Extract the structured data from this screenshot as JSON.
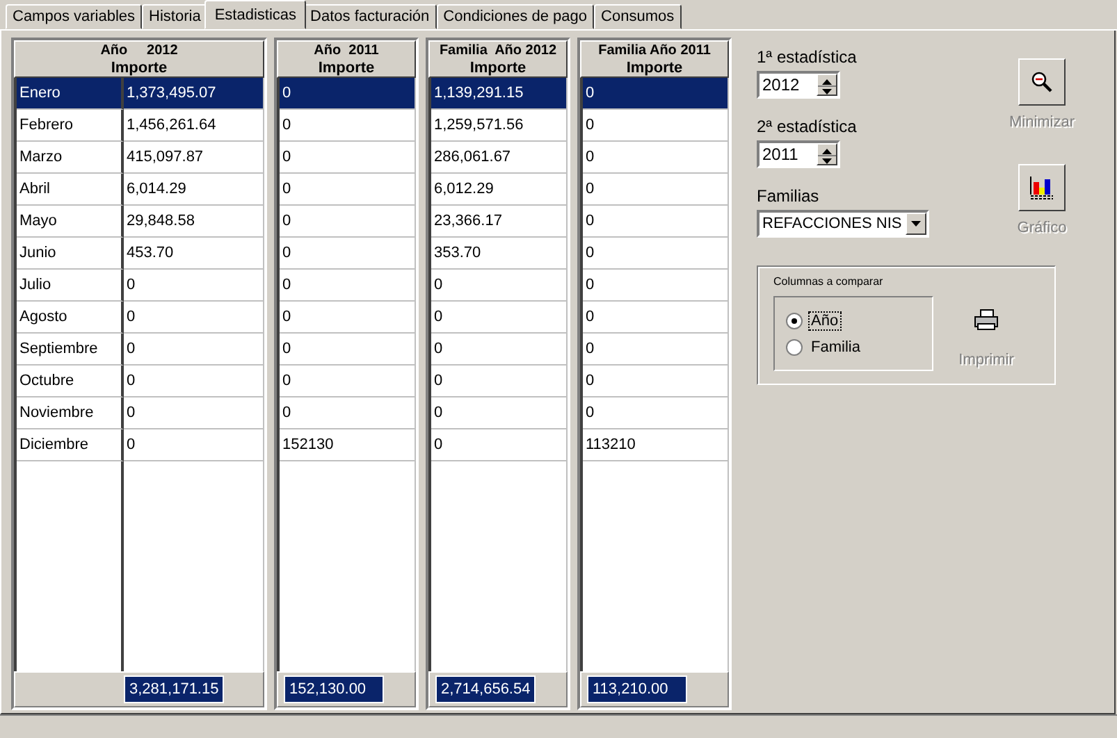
{
  "tabs": [
    {
      "label": "Campos variables",
      "selected": false
    },
    {
      "label": "Historia",
      "selected": false
    },
    {
      "label": "Estadisticas",
      "selected": true
    },
    {
      "label": "Datos facturación",
      "selected": false
    },
    {
      "label": "Condiciones de pago",
      "selected": false
    },
    {
      "label": "Consumos",
      "selected": false
    }
  ],
  "grid": {
    "columns": [
      {
        "title": "Año     2012",
        "subtitle": "Importe",
        "total": "3,281,171.15"
      },
      {
        "title": "Año  2011",
        "subtitle": "Importe",
        "total": "152,130.00"
      },
      {
        "title": "Familia  Año 2012",
        "subtitle": "Importe",
        "total": "2,714,656.54"
      },
      {
        "title": "Familia Año 2011",
        "subtitle": "Importe",
        "total": "113,210.00"
      }
    ],
    "rows": [
      {
        "month": "Enero",
        "values": [
          "1,373,495.07",
          "0",
          "1,139,291.15",
          "0"
        ],
        "selected": true
      },
      {
        "month": "Febrero",
        "values": [
          "1,456,261.64",
          "0",
          "1,259,571.56",
          "0"
        ],
        "selected": false
      },
      {
        "month": "Marzo",
        "values": [
          "415,097.87",
          "0",
          "286,061.67",
          "0"
        ],
        "selected": false
      },
      {
        "month": "Abril",
        "values": [
          "6,014.29",
          "0",
          "6,012.29",
          "0"
        ],
        "selected": false
      },
      {
        "month": "Mayo",
        "values": [
          "29,848.58",
          "0",
          "23,366.17",
          "0"
        ],
        "selected": false
      },
      {
        "month": "Junio",
        "values": [
          "453.70",
          "0",
          "353.70",
          "0"
        ],
        "selected": false
      },
      {
        "month": "Julio",
        "values": [
          "0",
          "0",
          "0",
          "0"
        ],
        "selected": false
      },
      {
        "month": "Agosto",
        "values": [
          "0",
          "0",
          "0",
          "0"
        ],
        "selected": false
      },
      {
        "month": "Septiembre",
        "values": [
          "0",
          "0",
          "0",
          "0"
        ],
        "selected": false
      },
      {
        "month": "Octubre",
        "values": [
          "0",
          "0",
          "0",
          "0"
        ],
        "selected": false
      },
      {
        "month": "Noviembre",
        "values": [
          "0",
          "0",
          "0",
          "0"
        ],
        "selected": false
      },
      {
        "month": "Diciembre",
        "values": [
          "0",
          "152130",
          "0",
          "113210"
        ],
        "selected": false
      }
    ]
  },
  "controls": {
    "stat1": {
      "label": "1ª estadística",
      "value": "2012"
    },
    "stat2": {
      "label": "2ª estadística",
      "value": "2011"
    },
    "family": {
      "label": "Familias",
      "value": "REFACCIONES NIS"
    },
    "buttons": [
      {
        "kind": "zoom",
        "label": "Minimizar",
        "disabled": true
      },
      {
        "kind": "chart",
        "label": "Gráfico",
        "disabled": true
      },
      {
        "kind": "print",
        "label": "Imprimir",
        "disabled": true
      }
    ],
    "compare": {
      "title": "Columnas a comparar",
      "options": [
        {
          "label": "Año",
          "selected": true
        },
        {
          "label": "Familia",
          "selected": false
        }
      ]
    }
  }
}
